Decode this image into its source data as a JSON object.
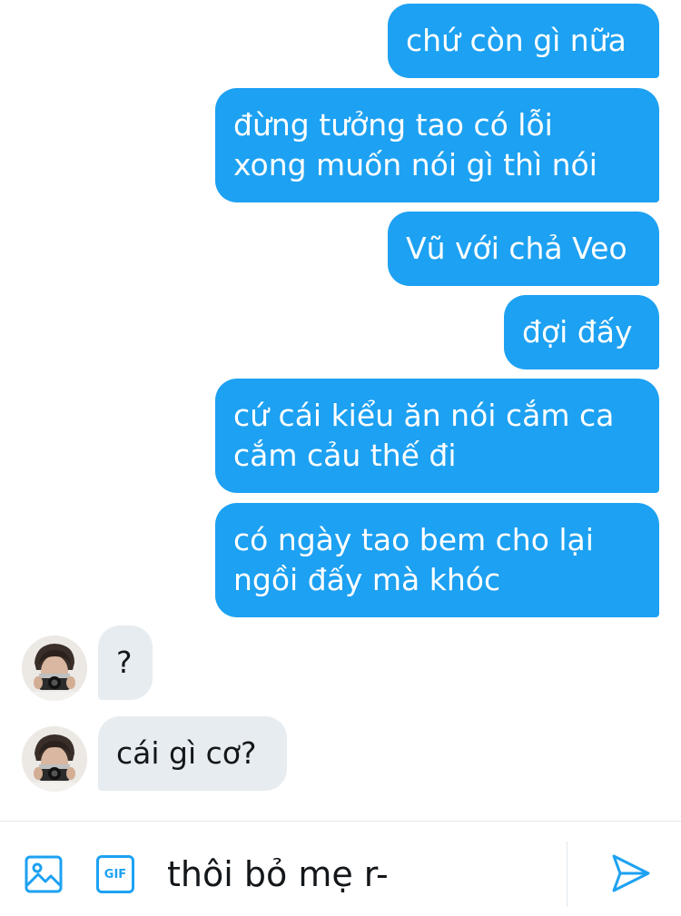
{
  "colors": {
    "accent": "#1DA1F2",
    "sent_bubble": "#1DA1F2",
    "received_bubble": "#E6ECF0",
    "text_dark": "#14171A"
  },
  "messages": [
    {
      "direction": "sent",
      "text": "chứ còn gì nữa"
    },
    {
      "direction": "sent",
      "text": "đừng tưởng tao có lỗi\nxong muốn nói gì thì nói"
    },
    {
      "direction": "sent",
      "text": "Vũ với chả Veo"
    },
    {
      "direction": "sent",
      "text": "đợi đấy"
    },
    {
      "direction": "sent",
      "text": "cứ cái kiểu ăn nói cắm ca\ncắm cảu thế đi"
    },
    {
      "direction": "sent",
      "text": "có ngày tao bem cho lại\nngồi đấy mà khóc"
    },
    {
      "direction": "received",
      "text": "?"
    },
    {
      "direction": "received",
      "text": "cái gì cơ?"
    }
  ],
  "composer": {
    "text": "thôi bỏ mẹ r-",
    "media_icon": "image-icon",
    "gif_icon": "gif-icon",
    "gif_label": "GIF",
    "send_icon": "send-icon"
  }
}
